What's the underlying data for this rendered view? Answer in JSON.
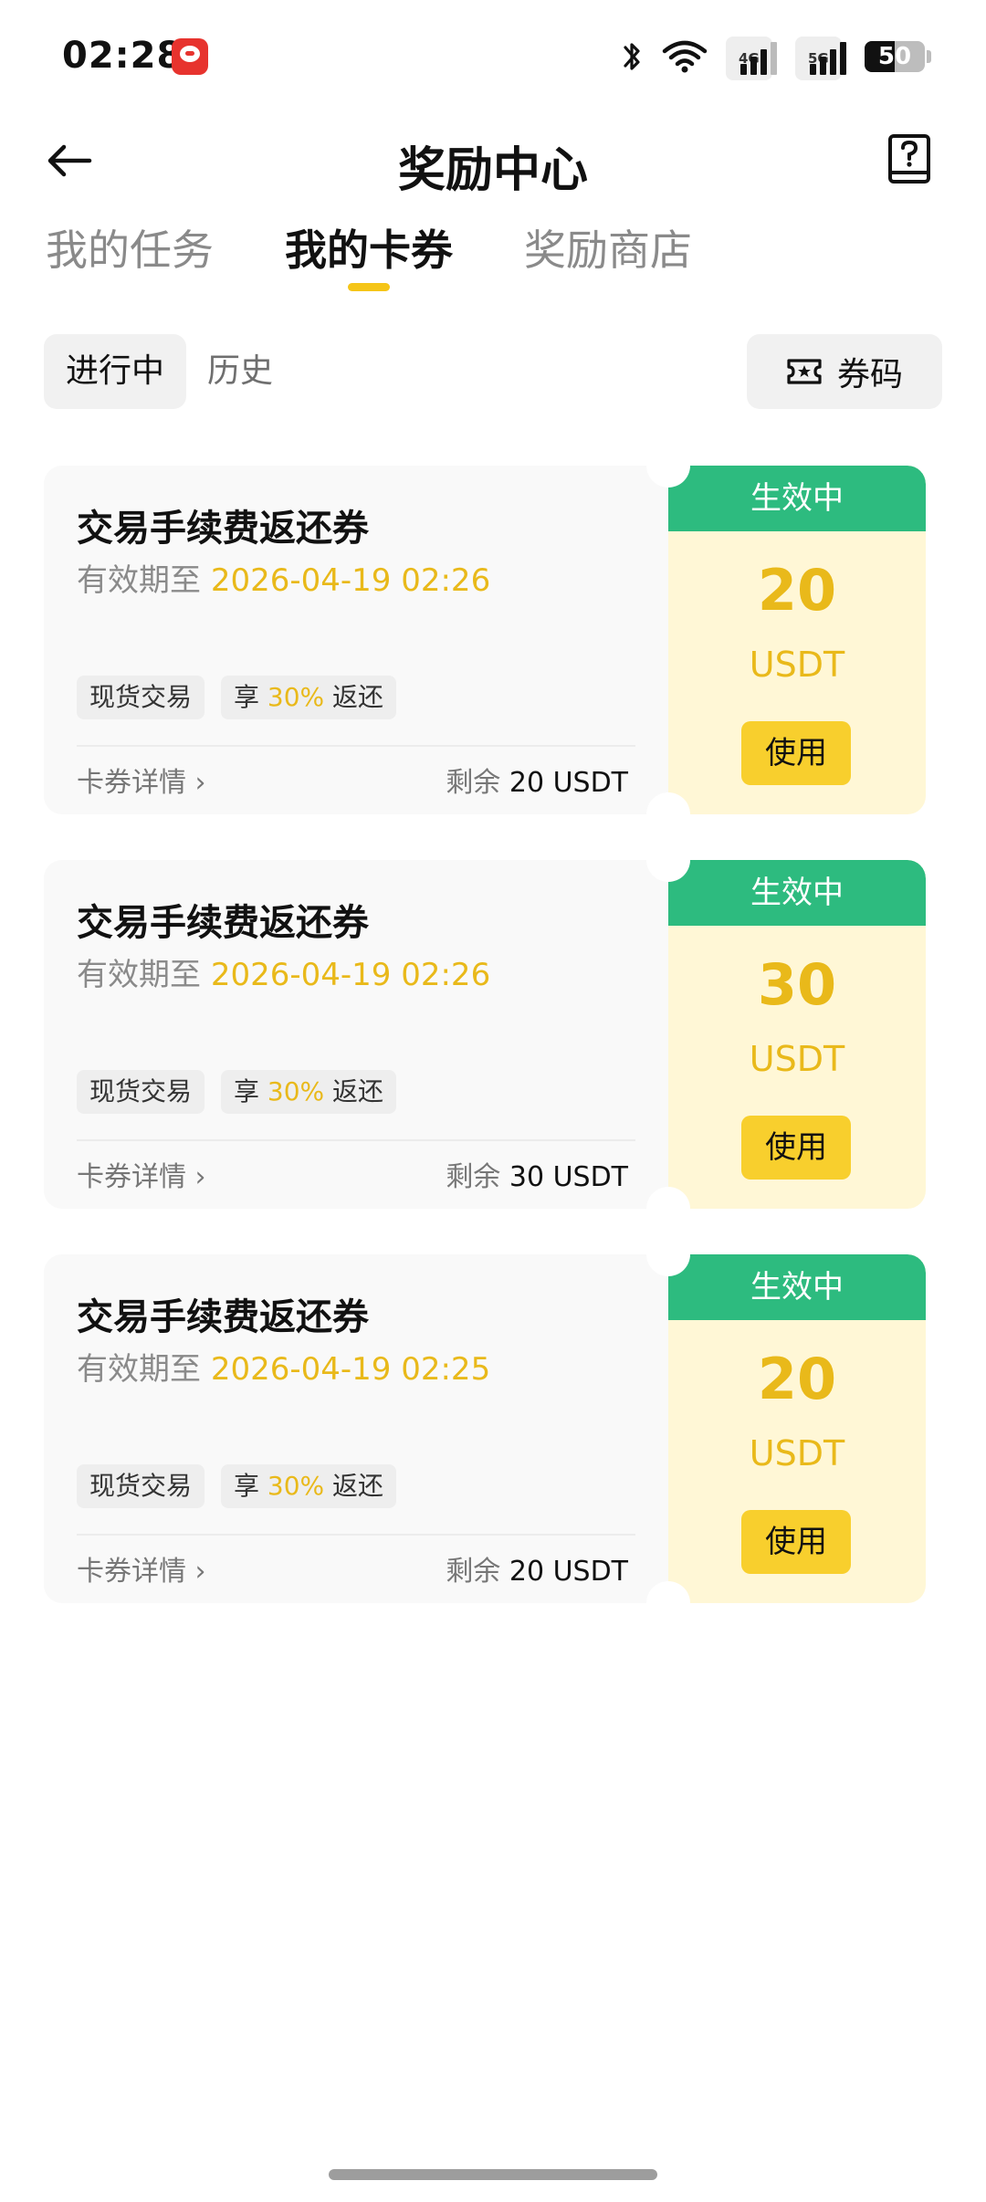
{
  "status_bar": {
    "time": "02:28",
    "net1": "4G",
    "net2": "5G",
    "battery": "50"
  },
  "header": {
    "title": "奖励中心"
  },
  "main_tabs": [
    {
      "label": "我的任务"
    },
    {
      "label": "我的卡券"
    },
    {
      "label": "奖励商店"
    }
  ],
  "sub_tabs": {
    "active": "进行中",
    "history": "历史",
    "coupon_code": "券码"
  },
  "cards": [
    {
      "title": "交易手续费返还券",
      "validity_label": "有效期至 ",
      "validity_date": "2026-04-19 02:26",
      "tag1": "现货交易",
      "tag2_prefix": "享 ",
      "tag2_pct": "30%",
      "tag2_suffix": " 返还",
      "detail": "卡券详情 ›",
      "remaining_label": "剩余 ",
      "remaining_amount": "20 USDT",
      "status": "生效中",
      "amount": "20",
      "currency": "USDT",
      "use_label": "使用"
    },
    {
      "title": "交易手续费返还券",
      "validity_label": "有效期至 ",
      "validity_date": "2026-04-19 02:26",
      "tag1": "现货交易",
      "tag2_prefix": "享 ",
      "tag2_pct": "30%",
      "tag2_suffix": " 返还",
      "detail": "卡券详情 ›",
      "remaining_label": "剩余 ",
      "remaining_amount": "30 USDT",
      "status": "生效中",
      "amount": "30",
      "currency": "USDT",
      "use_label": "使用"
    },
    {
      "title": "交易手续费返还券",
      "validity_label": "有效期至 ",
      "validity_date": "2026-04-19 02:25",
      "tag1": "现货交易",
      "tag2_prefix": "享 ",
      "tag2_pct": "30%",
      "tag2_suffix": " 返还",
      "detail": "卡券详情 ›",
      "remaining_label": "剩余 ",
      "remaining_amount": "20 USDT",
      "status": "生效中",
      "amount": "20",
      "currency": "USDT",
      "use_label": "使用"
    }
  ],
  "colors": {
    "accent_yellow": "#f5c518",
    "amount_gold": "#e9b91a",
    "status_green": "#2dbb7f",
    "card_right_bg": "#fff7d6",
    "use_button": "#f8cf2d"
  },
  "icons": {
    "back": "arrow-left-icon",
    "help": "question-book-icon",
    "coupon_code": "ticket-star-icon",
    "bluetooth": "bluetooth-icon",
    "wifi": "wifi-icon",
    "app": "notification-app-icon"
  }
}
